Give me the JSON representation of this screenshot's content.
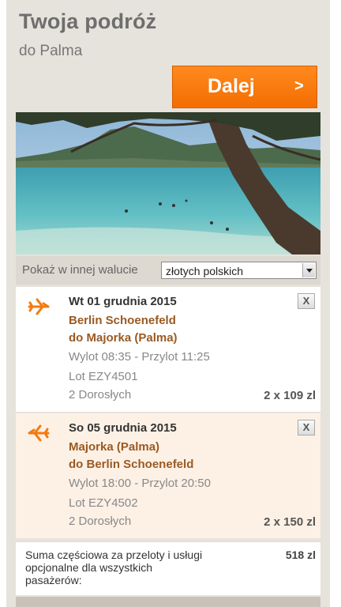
{
  "header": {
    "title": "Twoja podróż",
    "subtitle": "do Palma"
  },
  "next_button": {
    "label": "Dalej",
    "arrow": ">"
  },
  "currency": {
    "label": "Pokaż w innej walucie",
    "selected": "złotych polskich"
  },
  "flights": [
    {
      "date": "Wt 01 grudnia 2015",
      "from": "Berlin Schoenefeld",
      "to": "do Majorka (Palma)",
      "times": "Wylot 08:35 - Przylot 11:25",
      "flight_no": "Lot EZY4501",
      "passengers": "2 Dorosłych",
      "price": "2 x 109 zl",
      "remove": "X"
    },
    {
      "date": "So 05 grudnia 2015",
      "from": "Majorka (Palma)",
      "to": "do Berlin Schoenefeld",
      "times": "Wylot 18:00 - Przylot 20:50",
      "flight_no": "Lot EZY4502",
      "passengers": "2 Dorosłych",
      "price": "2 x 150 zl",
      "remove": "X"
    }
  ],
  "summary": {
    "label": "Suma częściowa za przeloty i usługi opcjonalne dla wszystkich pasażerów:",
    "amount": "518 zl"
  },
  "colors": {
    "accent": "#f47a0e",
    "panel": "#e6e2dc",
    "return_row": "#fdf1e6"
  },
  "icons": {
    "outbound": "plane-right-icon",
    "return": "plane-left-icon"
  }
}
